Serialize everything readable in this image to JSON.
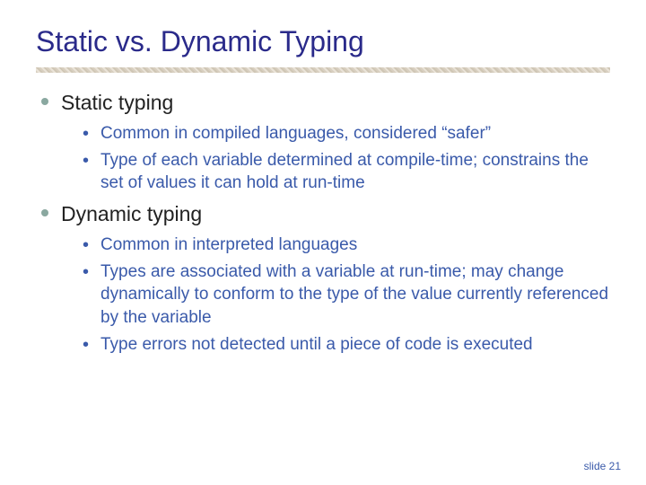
{
  "title": "Static vs. Dynamic Typing",
  "sections": [
    {
      "heading": "Static typing",
      "items": [
        "Common in compiled languages, considered “safer”",
        "Type of each variable determined at compile-time; constrains the set of values it can hold at run-time"
      ]
    },
    {
      "heading": "Dynamic typing",
      "items": [
        "Common in interpreted languages",
        "Types are associated with a variable at run-time; may change dynamically to conform to the type of the value currently referenced by the variable",
        "Type errors not detected until a piece of code is executed"
      ]
    }
  ],
  "footer": "slide 21"
}
